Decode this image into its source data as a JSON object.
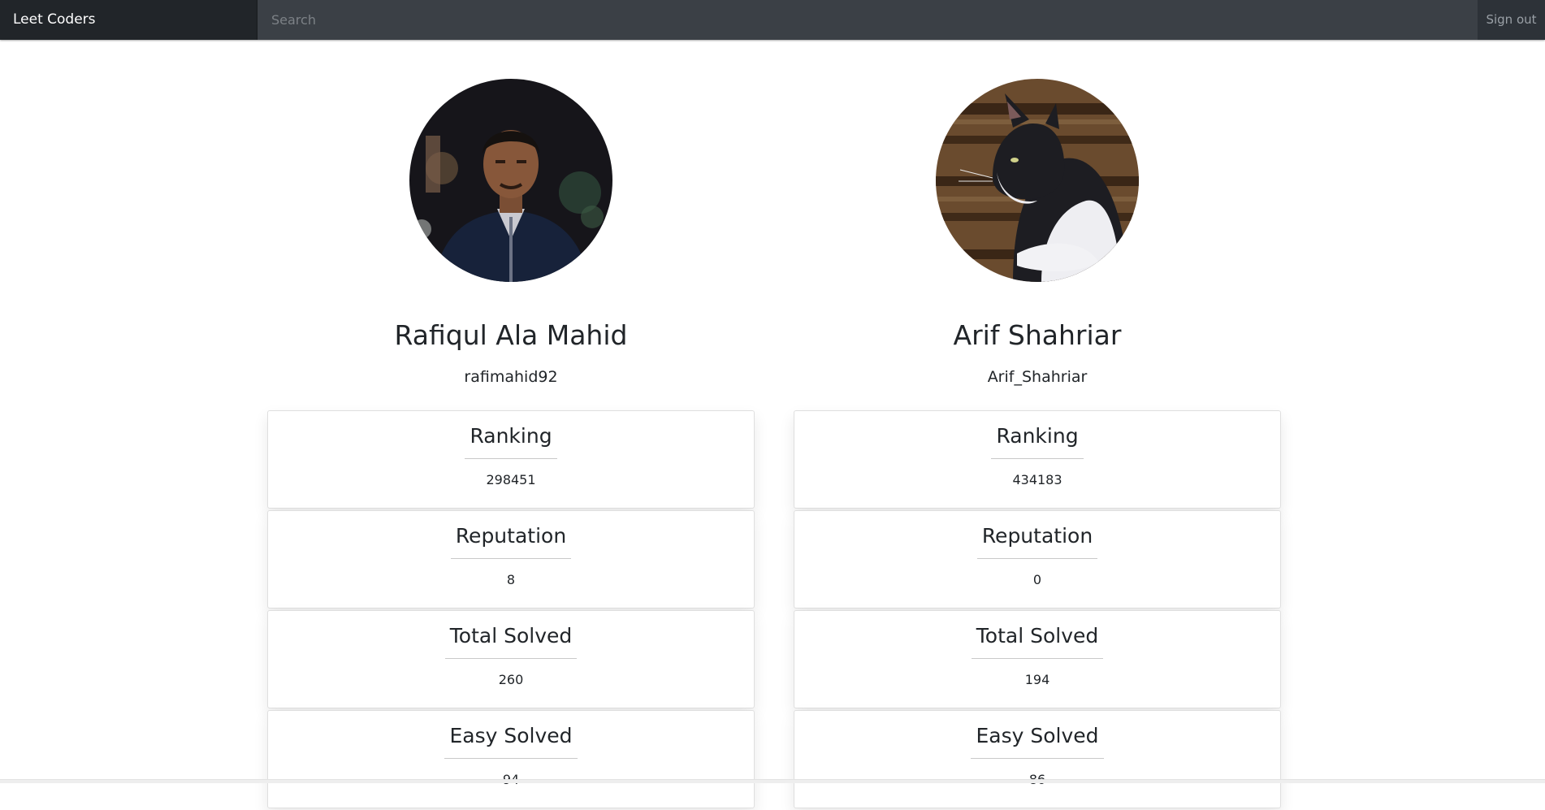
{
  "navbar": {
    "brand": "Leet Coders",
    "search_placeholder": "Search",
    "signout_label": "Sign out"
  },
  "profiles": [
    {
      "name": "Rafiqul Ala Mahid",
      "username": "rafimahid92",
      "stats": [
        {
          "label": "Ranking",
          "value": "298451"
        },
        {
          "label": "Reputation",
          "value": "8"
        },
        {
          "label": "Total Solved",
          "value": "260"
        },
        {
          "label": "Easy Solved",
          "value": "94"
        }
      ]
    },
    {
      "name": "Arif Shahriar",
      "username": "Arif_Shahriar",
      "stats": [
        {
          "label": "Ranking",
          "value": "434183"
        },
        {
          "label": "Reputation",
          "value": "0"
        },
        {
          "label": "Total Solved",
          "value": "194"
        },
        {
          "label": "Easy Solved",
          "value": "86"
        }
      ]
    }
  ]
}
